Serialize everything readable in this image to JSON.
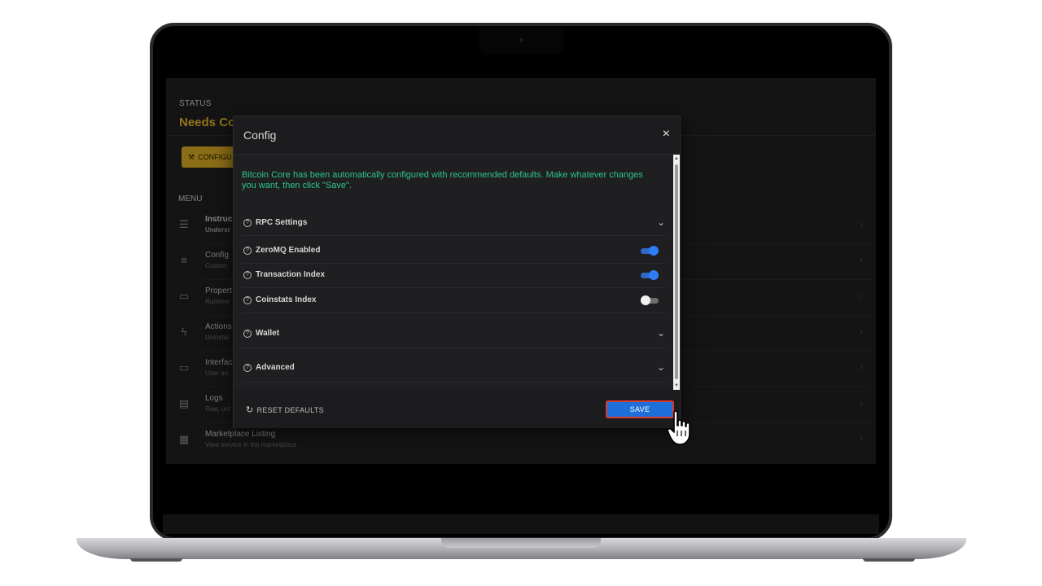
{
  "status": {
    "label": "STATUS",
    "value": "Needs Co",
    "config_button": "CONFIGU"
  },
  "menu": {
    "label": "MENU",
    "items": [
      {
        "icon": "list-icon",
        "title": "Instruc",
        "subtitle": "Underst"
      },
      {
        "icon": "sliders-icon",
        "title": "Config",
        "subtitle": "Custom"
      },
      {
        "icon": "briefcase-icon",
        "title": "Propert",
        "subtitle": "Runtime"
      },
      {
        "icon": "bolt-icon",
        "title": "Actions",
        "subtitle": "Uninstal"
      },
      {
        "icon": "monitor-icon",
        "title": "Interfac",
        "subtitle": "User an"
      },
      {
        "icon": "log-icon",
        "title": "Logs",
        "subtitle": "Raw, unf"
      },
      {
        "icon": "store-icon",
        "title": "Marketplace Listing",
        "subtitle": "View service in the marketplace"
      }
    ]
  },
  "modal": {
    "title": "Config",
    "close_symbol": "×",
    "intro": "Bitcoin Core has been automatically configured with recommended defaults. Make whatever changes you want, then click \"Save\".",
    "rows": [
      {
        "label": "RPC Settings",
        "kind": "expand"
      },
      {
        "label": "ZeroMQ Enabled",
        "kind": "toggle",
        "enabled": true
      },
      {
        "label": "Transaction Index",
        "kind": "toggle",
        "enabled": true
      },
      {
        "label": "Coinstats Index",
        "kind": "toggle",
        "enabled": false
      },
      {
        "label": "Wallet",
        "kind": "expand"
      },
      {
        "label": "Advanced",
        "kind": "expand"
      }
    ],
    "footer": {
      "reset_label": "RESET DEFAULTS",
      "save_label": "SAVE"
    }
  },
  "colors": {
    "accent_yellow": "#d6a824",
    "intro_green": "#2ec58a",
    "toggle_on": "#2e7cf6",
    "save_blue": "#1e6fd9",
    "highlight_red": "#e03a2e"
  }
}
